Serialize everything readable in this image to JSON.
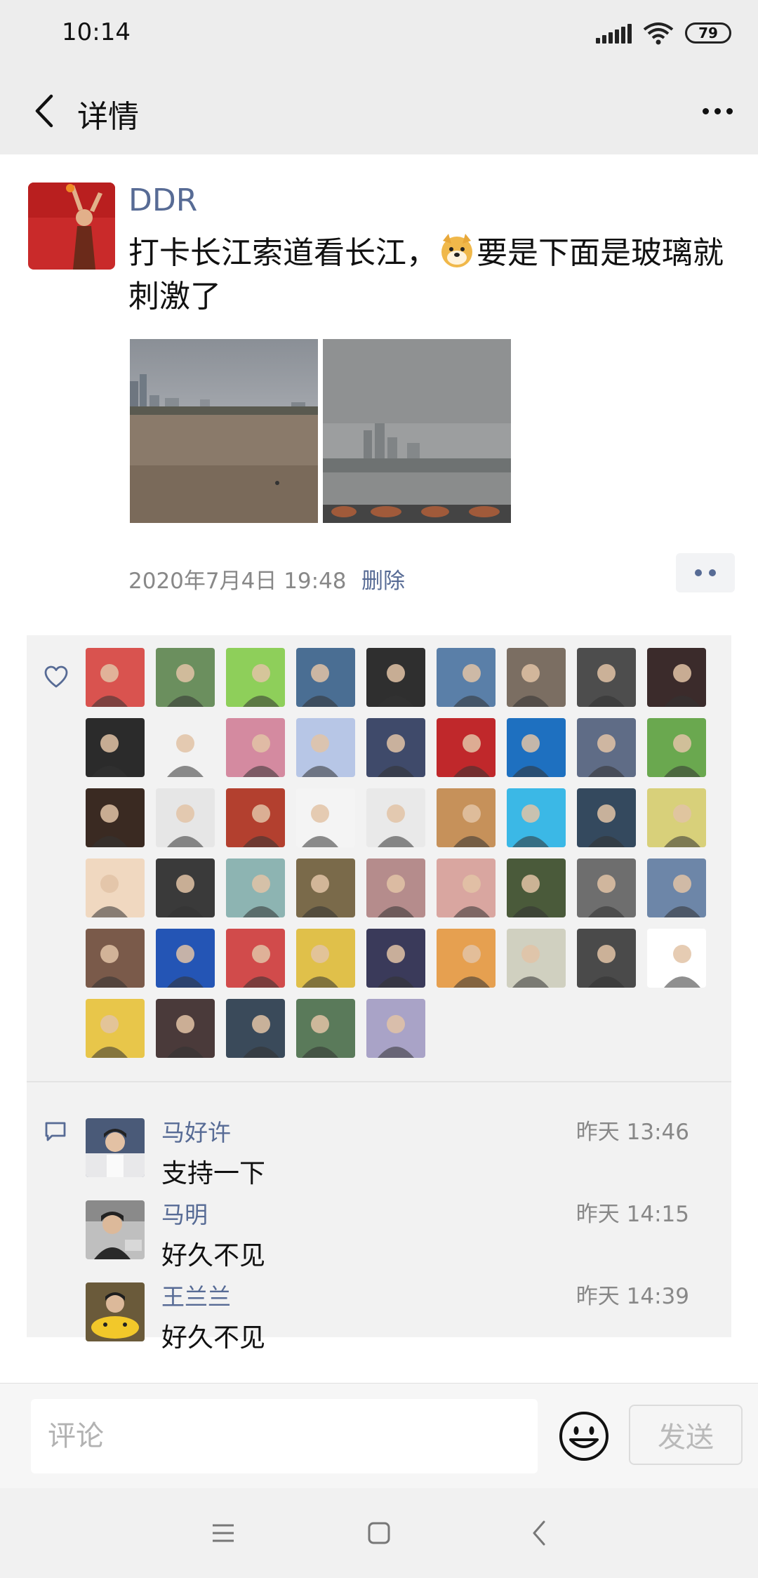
{
  "status_bar": {
    "time": "10:14",
    "battery": "79"
  },
  "nav": {
    "title": "详情",
    "back_icon": "chevron-left-icon",
    "more_icon": "ellipsis-icon"
  },
  "post": {
    "author": "DDR",
    "text_before_emoji": "打卡长江索道看长江，",
    "emoji": "doge-emoji",
    "text_after_emoji": "要是下面是玻璃就刺激了",
    "photos": [
      {
        "description": "river-city-skyline-photo"
      },
      {
        "description": "foggy-city-cable-car-photo"
      }
    ],
    "time": "2020年7月4日 19:48",
    "delete_label": "删除"
  },
  "likes": {
    "icon": "heart-icon",
    "avatars": [
      "#d9534f",
      "#6b8f5e",
      "#8ecf5a",
      "#4a6e93",
      "#2f2f2f",
      "#5a7fa8",
      "#7b6e62",
      "#4d4d4d",
      "#3b2b2b",
      "#2b2b2b",
      "#f2f2f2",
      "#d48aa0",
      "#b7c6e6",
      "#3f4a6a",
      "#c0282b",
      "#1e70c0",
      "#5f6c86",
      "#6aa84f",
      "#3a2a22",
      "#e6e6e6",
      "#b3402f",
      "#f4f4f4",
      "#e9e9e9",
      "#c6915a",
      "#3bb8e6",
      "#34495e",
      "#d8d07a",
      "#f0d8c0",
      "#3a3a3a",
      "#8db4b2",
      "#7a6a4a",
      "#b58c8c",
      "#d9a6a0",
      "#4a5a3a",
      "#6e6e6e",
      "#6d86a8",
      "#7a5a4a",
      "#2455b5",
      "#d14b4b",
      "#e0c04a",
      "#3a3a5a",
      "#e6a050",
      "#d0d0c0",
      "#4a4a4a",
      "#ffffff",
      "#e8c64a",
      "#4a3a3a",
      "#3a4a5a",
      "#5a7a5a",
      "#a9a3c7"
    ]
  },
  "comments": {
    "icon": "comment-icon",
    "items": [
      {
        "name": "马好许",
        "time": "昨天 13:46",
        "text": "支持一下",
        "avatar_color": "#4a5a78"
      },
      {
        "name": "马明",
        "time": "昨天 14:15",
        "text": "好久不见",
        "avatar_color": "#3a3a3a"
      },
      {
        "name": "王兰兰",
        "time": "昨天 14:39",
        "text": "好久不见",
        "avatar_color": "#6a5a3a"
      }
    ]
  },
  "input_bar": {
    "placeholder": "评论",
    "emoji_icon": "smiley-icon",
    "send_label": "发送"
  },
  "system_nav": {
    "menu_icon": "menu-icon",
    "home_icon": "home-square-icon",
    "back_icon": "back-triangle-icon"
  }
}
